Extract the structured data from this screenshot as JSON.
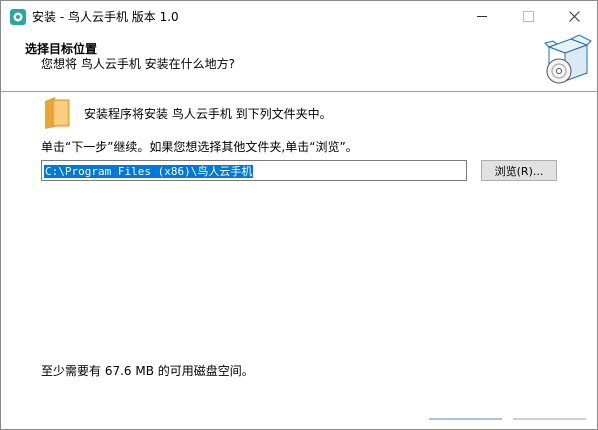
{
  "window": {
    "title": "安装 - 鸟人云手机 版本 1.0"
  },
  "header": {
    "title": "选择目标位置",
    "subtitle": "您想将 鸟人云手机 安装在什么地方?"
  },
  "body": {
    "info": "安装程序将安装 鸟人云手机 到下列文件夹中。",
    "instruction": "单击“下一步”继续。如果您想选择其他文件夹,单击“浏览”。",
    "path_value": "C:\\Program Files (x86)\\鸟人云手机",
    "browse_label": "浏览(R)...",
    "space_required": "至少需要有 67.6 MB 的可用磁盘空间。"
  },
  "colors": {
    "selection": "#0078d7",
    "folder": "#f2b94a"
  }
}
